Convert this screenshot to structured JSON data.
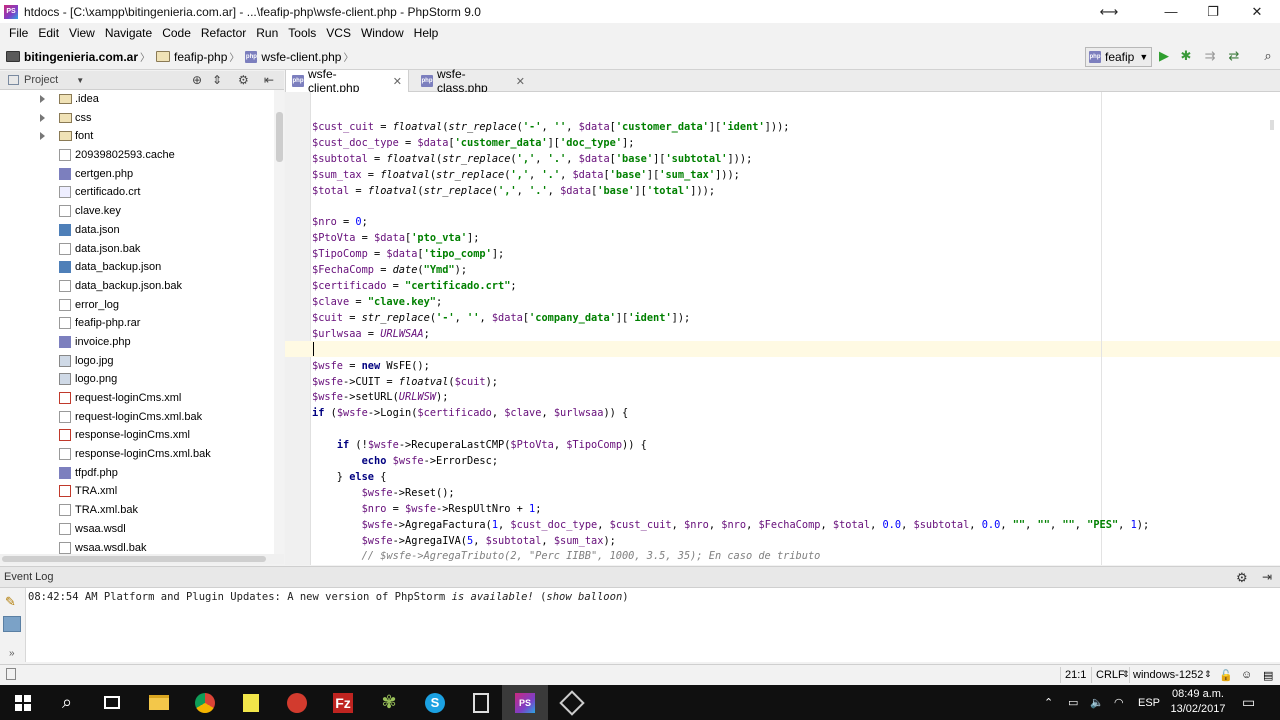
{
  "window": {
    "title": "htdocs - [C:\\xampp\\bitingenieria.com.ar] - ...\\feafip-php\\wsfe-client.php - PhpStorm 9.0"
  },
  "menu": [
    "File",
    "Edit",
    "View",
    "Navigate",
    "Code",
    "Refactor",
    "Run",
    "Tools",
    "VCS",
    "Window",
    "Help"
  ],
  "breadcrumb": [
    "bitingenieria.com.ar",
    "feafip-php",
    "wsfe-client.php"
  ],
  "run_config": "feafip",
  "project_panel": {
    "title": "Project",
    "items": [
      {
        "name": ".idea",
        "type": "folder"
      },
      {
        "name": "css",
        "type": "folder"
      },
      {
        "name": "font",
        "type": "folder"
      },
      {
        "name": "20939802593.cache",
        "type": "file"
      },
      {
        "name": "certgen.php",
        "type": "php"
      },
      {
        "name": "certificado.crt",
        "type": "cfg"
      },
      {
        "name": "clave.key",
        "type": "file"
      },
      {
        "name": "data.json",
        "type": "json"
      },
      {
        "name": "data.json.bak",
        "type": "file"
      },
      {
        "name": "data_backup.json",
        "type": "json"
      },
      {
        "name": "data_backup.json.bak",
        "type": "file"
      },
      {
        "name": "error_log",
        "type": "file"
      },
      {
        "name": "feafip-php.rar",
        "type": "file"
      },
      {
        "name": "invoice.php",
        "type": "php"
      },
      {
        "name": "logo.jpg",
        "type": "img"
      },
      {
        "name": "logo.png",
        "type": "img"
      },
      {
        "name": "request-loginCms.xml",
        "type": "xml"
      },
      {
        "name": "request-loginCms.xml.bak",
        "type": "file"
      },
      {
        "name": "response-loginCms.xml",
        "type": "xml"
      },
      {
        "name": "response-loginCms.xml.bak",
        "type": "file"
      },
      {
        "name": "tfpdf.php",
        "type": "php"
      },
      {
        "name": "TRA.xml",
        "type": "xml"
      },
      {
        "name": "TRA.xml.bak",
        "type": "file"
      },
      {
        "name": "wsaa.wsdl",
        "type": "file"
      },
      {
        "name": "wsaa.wsdl.bak",
        "type": "file"
      }
    ]
  },
  "tabs": [
    {
      "label": "wsfe-client.php",
      "active": true
    },
    {
      "label": "wsfe-class.php",
      "active": false
    }
  ],
  "code_lines": [
    "$cust_cuit = floatval(str_replace('-', '', $data['customer_data']['ident']));",
    "$cust_doc_type = $data['customer_data']['doc_type'];",
    "$subtotal = floatval(str_replace(',', '.', $data['base']['subtotal']));",
    "$sum_tax = floatval(str_replace(',', '.', $data['base']['sum_tax']));",
    "$total = floatval(str_replace(',', '.', $data['base']['total']));",
    "",
    "$nro = 0;",
    "$PtoVta = $data['pto_vta'];",
    "$TipoComp = $data['tipo_comp'];",
    "$FechaComp = date(\"Ymd\");",
    "$certificado = \"certificado.crt\";",
    "$clave = \"clave.key\";",
    "$cuit = str_replace('-', '', $data['company_data']['ident']);",
    "$urlwsaa = URLWSAA;",
    "",
    "$wsfe = new WsFE();",
    "$wsfe->CUIT = floatval($cuit);",
    "$wsfe->setURL(URLWSW);",
    "if ($wsfe->Login($certificado, $clave, $urlwsaa)) {",
    "",
    "    if (!$wsfe->RecuperaLastCMP($PtoVta, $TipoComp)) {",
    "        echo $wsfe->ErrorDesc;",
    "    } else {",
    "        $wsfe->Reset();",
    "        $nro = $wsfe->RespUltNro + 1;",
    "        $wsfe->AgregaFactura(1, $cust_doc_type, $cust_cuit, $nro, $nro, $FechaComp, $total, 0.0, $subtotal, 0.0, \"\", \"\", \"\", \"PES\", 1);",
    "        $wsfe->AgregaIVA(5, $subtotal, $sum_tax);",
    "        // $wsfe->AgregaTributo(2, \"Perc IIBB\", 1000, 3.5, 35); En caso de tributo"
  ],
  "event_log": {
    "title": "Event Log",
    "message_time": "08:42:54 AM",
    "message_prefix": "Platform and Plugin Updates: A new version of PhpStorm ",
    "message_em": "is available!",
    "message_link": "show balloon"
  },
  "status": {
    "position": "21:1",
    "line_sep": "CRLF",
    "encoding": "windows-1252"
  },
  "taskbar": {
    "lang": "ESP",
    "time": "08:49 a.m.",
    "date": "13/02/2017"
  }
}
